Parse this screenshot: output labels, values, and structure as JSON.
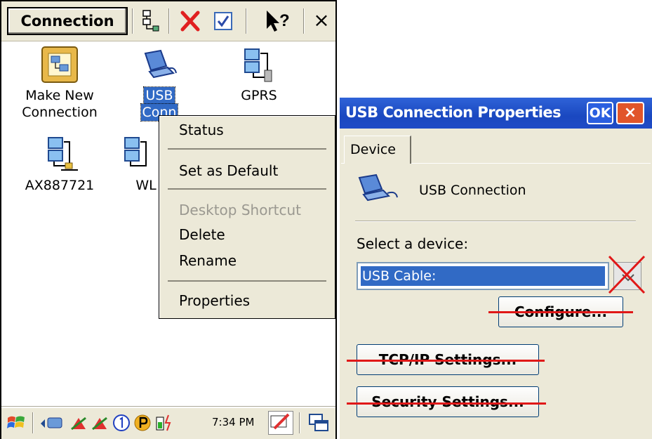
{
  "left_window": {
    "title": "Connection",
    "toolbar_icons": [
      "connection-properties-icon",
      "delete-icon",
      "checkbox-icon",
      "help-pointer-icon",
      "close-icon"
    ],
    "close_label": "×",
    "help_label": "?",
    "icons": [
      {
        "line1": "Make New",
        "line2": "Connection",
        "icon": "make-new-connection-icon"
      },
      {
        "line1": "USB",
        "line2": "Conn",
        "icon": "usb-connection-icon",
        "selected": true
      },
      {
        "line1": "GPRS",
        "line2": "",
        "icon": "gprs-connection-icon"
      },
      {
        "line1": "AX887721",
        "line2": "",
        "icon": "network-adapter-icon"
      },
      {
        "line1": "WL",
        "line2": "",
        "icon": "wireless-adapter-icon"
      }
    ],
    "context_menu": {
      "items": [
        "Status",
        "Set as Default",
        "Desktop Shortcut",
        "Delete",
        "Rename",
        "Properties"
      ],
      "disabled": [
        "Desktop Shortcut"
      ]
    },
    "taskbar": {
      "clock": "7:34 PM",
      "status_icons": [
        "start-icon",
        "network-status-icon",
        "bluetooth-icon",
        "bluetooth-icon",
        "circled-one-icon",
        "parking-icon",
        "battery-icon",
        "keyboard-icon",
        "window-switch-icon"
      ]
    }
  },
  "dialog": {
    "title": "USB Connection Properties",
    "ok_label": "OK",
    "close_label": "×",
    "tab": "Device",
    "connection_name": "USB Connection",
    "select_label": "Select a device:",
    "select_value": "USB Cable:",
    "buttons": {
      "configure": "Configure...",
      "tcpip": "TCP/IP Settings...",
      "security": "Security Settings..."
    },
    "annotation_color": "#e01818"
  }
}
